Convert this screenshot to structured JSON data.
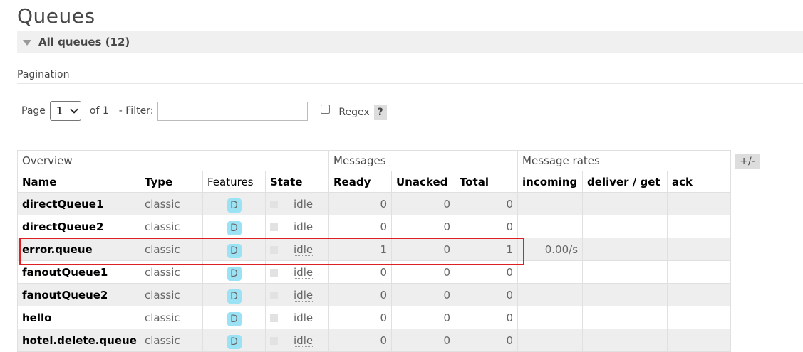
{
  "page": {
    "title": "Queues"
  },
  "section": {
    "label": "All queues (12)"
  },
  "pagination": {
    "label": "Pagination",
    "page_label": "Page",
    "page_value": "1",
    "of_label": "of 1",
    "filter_label": "- Filter:",
    "filter_value": "",
    "regex_label": "Regex",
    "help_label": "?"
  },
  "table": {
    "groups": [
      "Overview",
      "Messages",
      "Message rates"
    ],
    "columns": [
      "Name",
      "Type",
      "Features",
      "State",
      "Ready",
      "Unacked",
      "Total",
      "incoming",
      "deliver / get",
      "ack"
    ],
    "toggle_label": "+/-",
    "rows": [
      {
        "name": "directQueue1",
        "type": "classic",
        "feature": "D",
        "state": "idle",
        "ready": "0",
        "unacked": "0",
        "total": "0",
        "incoming": "",
        "deliver": "",
        "ack": ""
      },
      {
        "name": "directQueue2",
        "type": "classic",
        "feature": "D",
        "state": "idle",
        "ready": "0",
        "unacked": "0",
        "total": "0",
        "incoming": "",
        "deliver": "",
        "ack": ""
      },
      {
        "name": "error.queue",
        "type": "classic",
        "feature": "D",
        "state": "idle",
        "ready": "1",
        "unacked": "0",
        "total": "1",
        "incoming": "0.00/s",
        "deliver": "",
        "ack": ""
      },
      {
        "name": "fanoutQueue1",
        "type": "classic",
        "feature": "D",
        "state": "idle",
        "ready": "0",
        "unacked": "0",
        "total": "0",
        "incoming": "",
        "deliver": "",
        "ack": ""
      },
      {
        "name": "fanoutQueue2",
        "type": "classic",
        "feature": "D",
        "state": "idle",
        "ready": "0",
        "unacked": "0",
        "total": "0",
        "incoming": "",
        "deliver": "",
        "ack": ""
      },
      {
        "name": "hello",
        "type": "classic",
        "feature": "D",
        "state": "idle",
        "ready": "0",
        "unacked": "0",
        "total": "0",
        "incoming": "",
        "deliver": "",
        "ack": ""
      },
      {
        "name": "hotel.delete.queue",
        "type": "classic",
        "feature": "D",
        "state": "idle",
        "ready": "0",
        "unacked": "0",
        "total": "0",
        "incoming": "",
        "deliver": "",
        "ack": ""
      }
    ]
  },
  "colors": {
    "highlight": "#e02020",
    "feature_badge": "#9ce2f5",
    "row_stripe": "#eeeeee"
  }
}
